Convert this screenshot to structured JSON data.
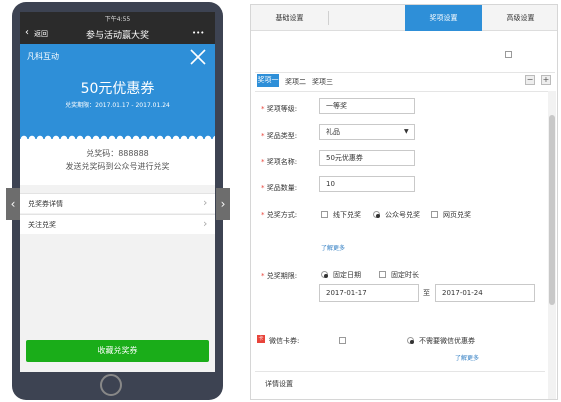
{
  "phone": {
    "status_time": "下午4:55",
    "nav": {
      "back_label": "返回",
      "title": "参与活动赢大奖",
      "more": "•••"
    },
    "coupon": {
      "brand": "凡科互动",
      "title": "50元优惠券",
      "validity": "兑奖期限：2017.01.17 - 2017.01.24"
    },
    "code": {
      "line1": "兑奖码：888888",
      "line2": "发送兑奖码到公众号进行兑奖"
    },
    "menu": [
      {
        "label": "兑奖券详情",
        "arrow": "›"
      },
      {
        "label": "关注兑奖",
        "arrow": "›"
      }
    ],
    "cta_label": "收藏兑奖券",
    "nav_arrows": {
      "left": "‹",
      "right": "›"
    }
  },
  "settings": {
    "tabs": [
      {
        "label": "基础设置",
        "active": false
      },
      {
        "label": "",
        "active": false
      },
      {
        "label": "奖项设置",
        "active": true
      },
      {
        "label": "高级设置",
        "active": false
      }
    ],
    "intro": "",
    "top_checkbox_label": "",
    "prize_tabs": [
      "奖项一",
      "奖项二",
      "奖项三"
    ],
    "minus": "−",
    "plus": "+",
    "fields": {
      "level": {
        "label": "奖项等级:",
        "value": "一等奖"
      },
      "type": {
        "label": "奖品类型:",
        "value": "礼品",
        "hint": ""
      },
      "name": {
        "label": "奖项名称:",
        "value": "50元优惠券",
        "hint": ""
      },
      "quantity": {
        "label": "奖品数量:",
        "value": "10"
      },
      "method": {
        "label": "兑奖方式:",
        "options": [
          "线下兑奖",
          "公众号兑奖",
          "网页兑奖"
        ],
        "selected": 1,
        "hint": "",
        "link": "了解更多"
      },
      "period": {
        "label": "兑奖期限:",
        "options": [
          "固定日期",
          "固定时长"
        ],
        "selected": 0,
        "start": "2017-01-17",
        "to": "至",
        "end": "2017-01-24",
        "hint": ""
      },
      "wechat_card": {
        "label": "微信卡券:",
        "options": [
          "",
          "不需要微信优惠券"
        ],
        "selected": 1,
        "hint": "",
        "link": "了解更多"
      }
    },
    "bottom_label": "详情设置",
    "colors": {
      "accent": "#2e8fd8",
      "green": "#1aad19",
      "required": "#e8443a"
    }
  }
}
